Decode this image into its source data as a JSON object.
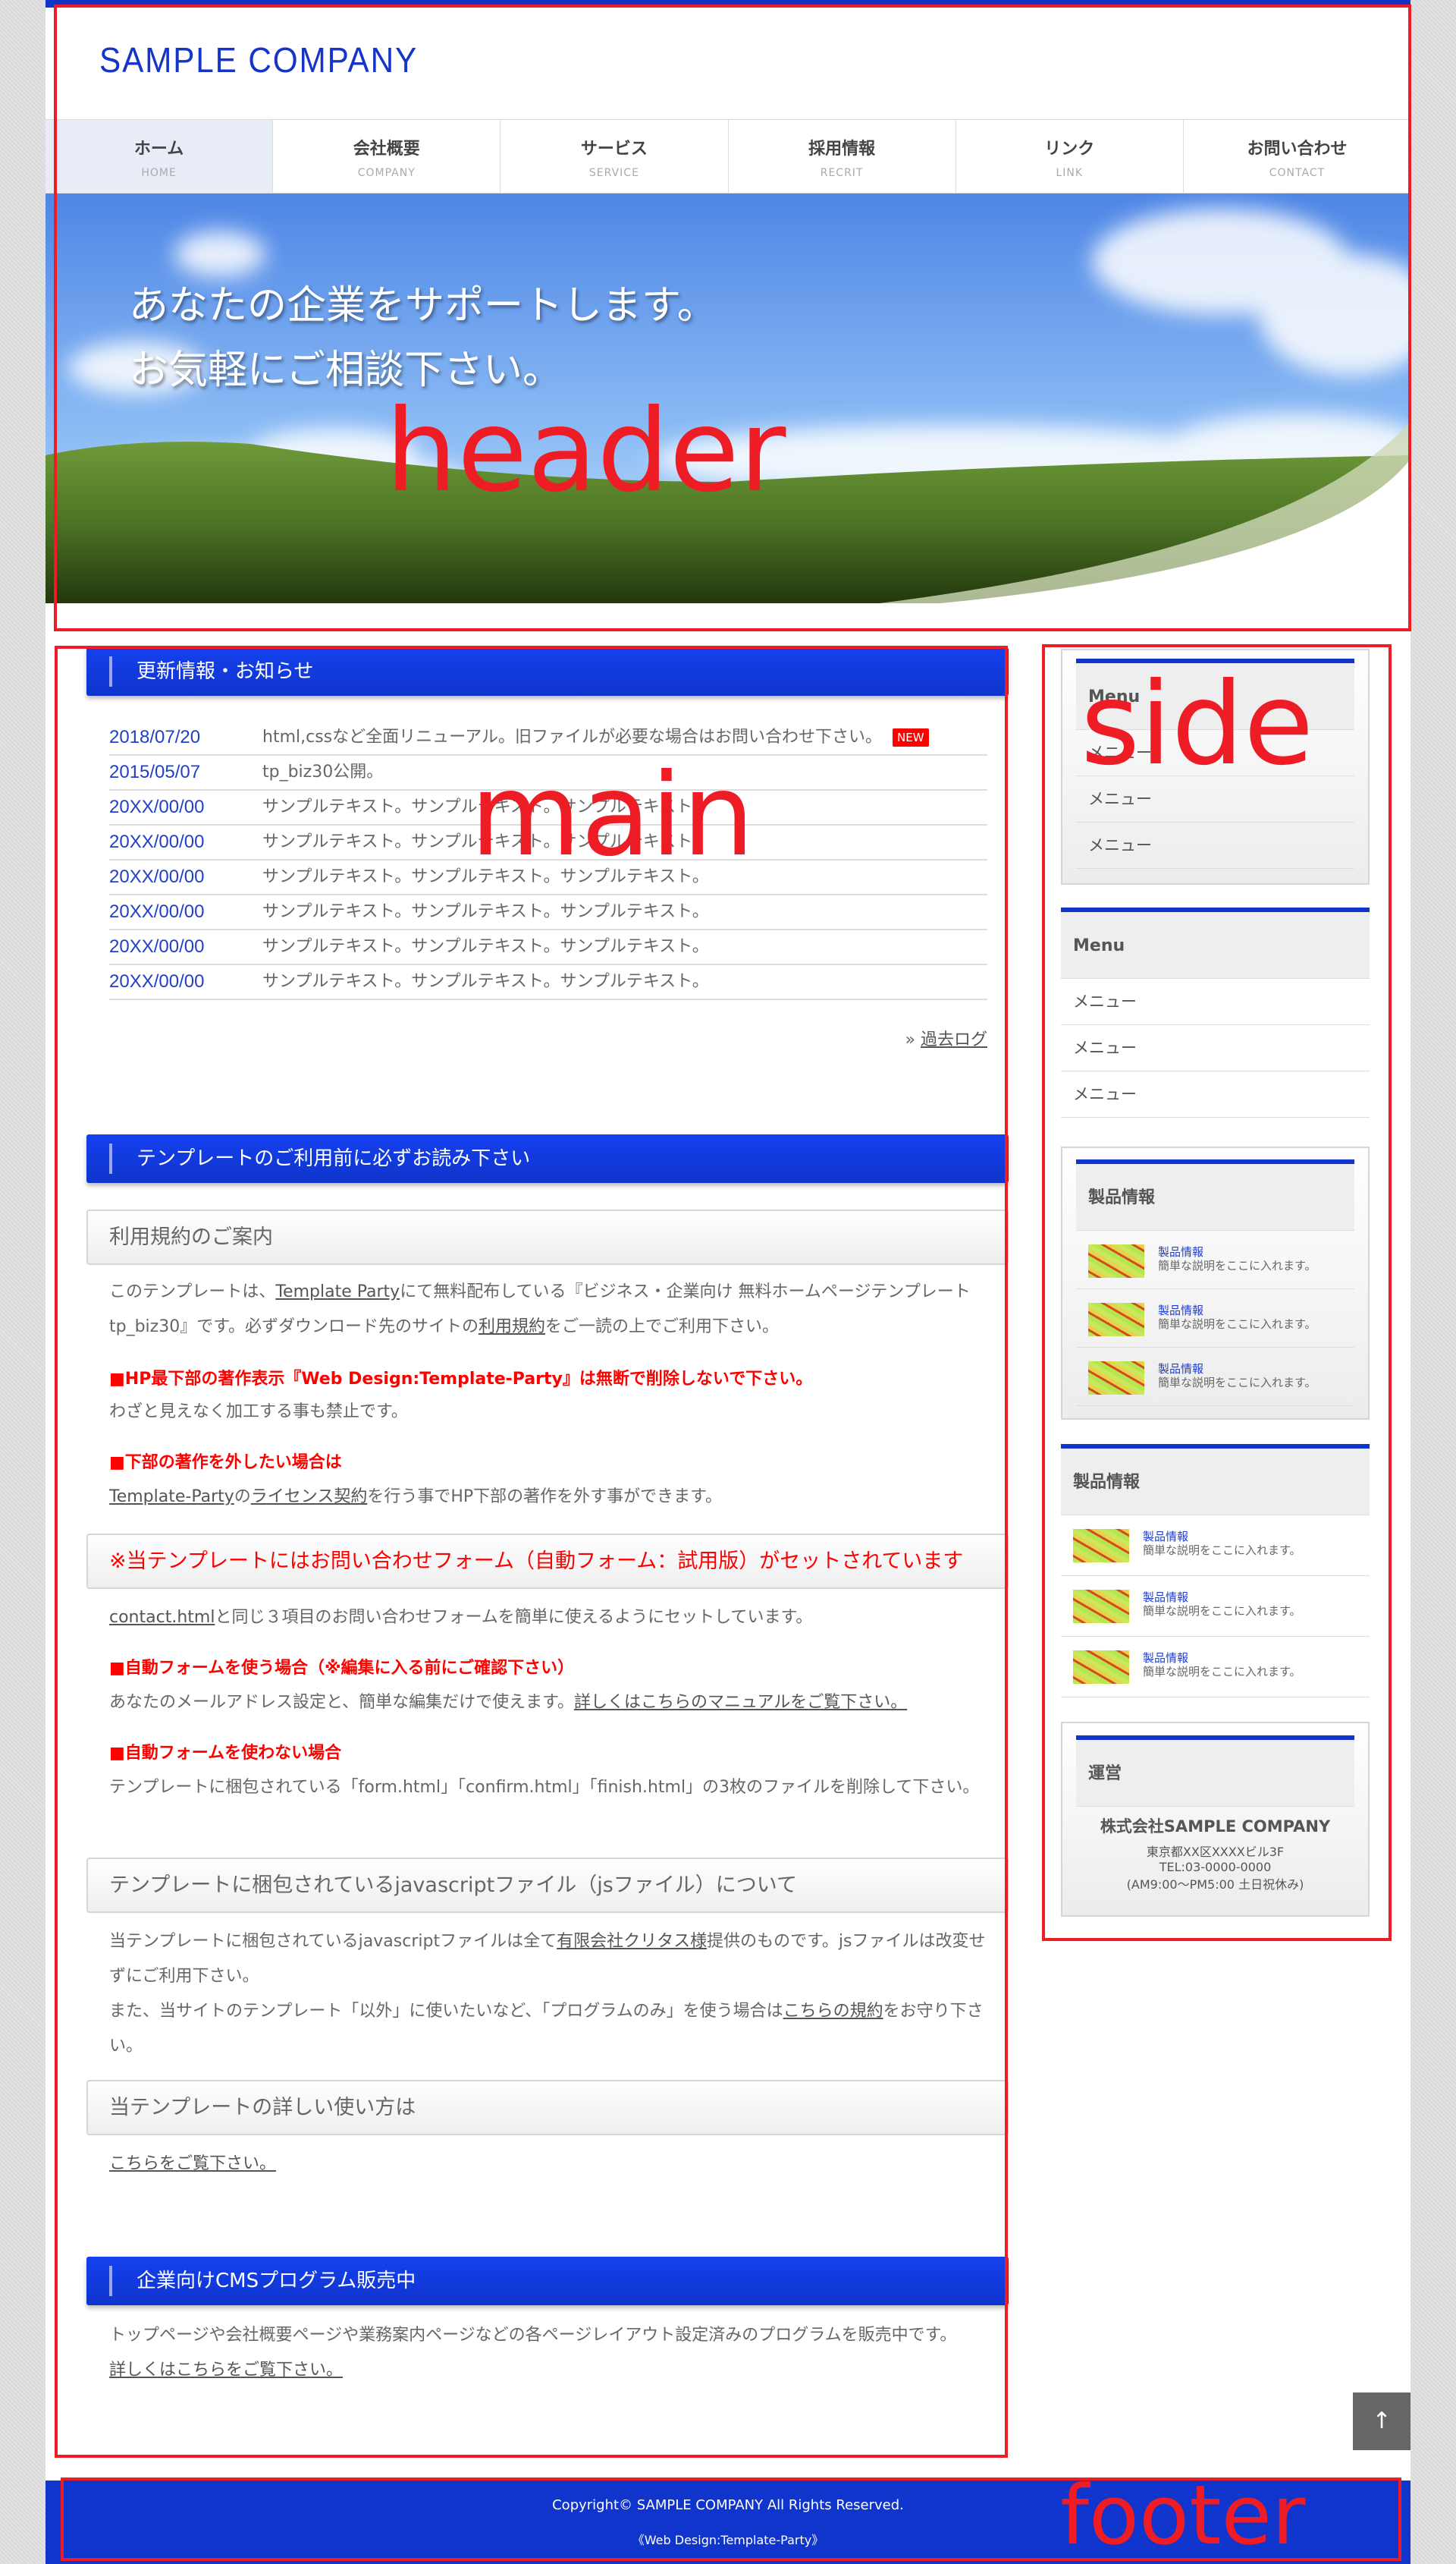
{
  "header": {
    "logo": "SAMPLE COMPANY",
    "nav": [
      {
        "jp": "ホーム",
        "en": "HOME"
      },
      {
        "jp": "会社概要",
        "en": "COMPANY"
      },
      {
        "jp": "サービス",
        "en": "SERVICE"
      },
      {
        "jp": "採用情報",
        "en": "RECRIT"
      },
      {
        "jp": "リンク",
        "en": "LINK"
      },
      {
        "jp": "お問い合わせ",
        "en": "CONTACT"
      }
    ],
    "hero": {
      "line1": "あなたの企業をサポートします。",
      "line2": "お気軽にご相談下さい。"
    }
  },
  "news": {
    "title": "更新情報・お知らせ",
    "badge": "NEW",
    "more_prefix": "»",
    "more": "過去ログ",
    "items": [
      {
        "date": "2018/07/20",
        "text": "html,cssなど全面リニューアル。旧ファイルが必要な場合はお問い合わせ下さい。"
      },
      {
        "date": "2015/05/07",
        "text": "tp_biz30公開。"
      },
      {
        "date": "20XX/00/00",
        "text": "サンプルテキスト。サンプルテキスト。サンプルテキスト。"
      },
      {
        "date": "20XX/00/00",
        "text": "サンプルテキスト。サンプルテキスト。サンプルテキスト。"
      },
      {
        "date": "20XX/00/00",
        "text": "サンプルテキスト。サンプルテキスト。サンプルテキスト。"
      },
      {
        "date": "20XX/00/00",
        "text": "サンプルテキスト。サンプルテキスト。サンプルテキスト。"
      },
      {
        "date": "20XX/00/00",
        "text": "サンプルテキスト。サンプルテキスト。サンプルテキスト。"
      },
      {
        "date": "20XX/00/00",
        "text": "サンプルテキスト。サンプルテキスト。サンプルテキスト。"
      }
    ]
  },
  "notice": {
    "title": "テンプレートのご利用前に必ずお読み下さい",
    "terms": {
      "title": "利用規約のご案内",
      "p1a": "このテンプレートは、",
      "p1link": "Template Party",
      "p1b": "にて無料配布している『ビジネス・企業向け 無料ホームページテンプレート tp_biz30』です。必ずダウンロード先のサイトの",
      "p1link2": "利用規約",
      "p1c": "をご一読の上でご利用下さい。",
      "h1": "■HP最下部の著作表示『Web Design:Template-Party』は無断で削除しないで下さい。",
      "t1": "わざと見えなく加工する事も禁止です。",
      "h2": "■下部の著作を外したい場合は",
      "t2link": "Template-Party",
      "t2a": "の",
      "t2link2": "ライセンス契約",
      "t2b": "を行う事でHP下部の著作を外す事ができます。"
    },
    "form": {
      "title": "※当テンプレートにはお問い合わせフォーム（自動フォーム：試用版）がセットされています",
      "p1link": "contact.html",
      "p1": "と同じ３項目のお問い合わせフォームを簡単に使えるようにセットしています。",
      "h1": "■自動フォームを使う場合（※編集に入る前にご確認下さい）",
      "t1": "あなたのメールアドレス設定と、簡単な編集だけで使えます。",
      "t1link": "詳しくはこちらのマニュアルをご覧下さい。",
      "h2": "■自動フォームを使わない場合",
      "t2": "テンプレートに梱包されている「form.html」「confirm.html」「finish.html」の3枚のファイルを削除して下さい。"
    },
    "js": {
      "title": "テンプレートに梱包されているjavascriptファイル（jsファイル）について",
      "p1a": "当テンプレートに梱包されているjavascriptファイルは全て",
      "p1link": "有限会社クリタス様",
      "p1b": "提供のものです。jsファイルは改変せずにご利用下さい。",
      "p2a": "また、当サイトのテンプレート「以外」に使いたいなど、「プログラムのみ」を使う場合は",
      "p2link": "こちらの規約",
      "p2b": "をお守り下さい。"
    },
    "usage": {
      "title": "当テンプレートの詳しい使い方は",
      "link": "こちらをご覧下さい。"
    }
  },
  "cms": {
    "title": "企業向けCMSプログラム販売中",
    "text": "トップページや会社概要ページや業務案内ページなどの各ページレイアウト設定済みのプログラムを販売中です。",
    "link": "詳しくはこちらをご覧下さい。"
  },
  "side": {
    "menu1": {
      "title": "Menu",
      "items": [
        "メニュー",
        "メニュー",
        "メニュー"
      ]
    },
    "menu2": {
      "title": "Menu",
      "items": [
        "メニュー",
        "メニュー",
        "メニュー"
      ]
    },
    "products1": {
      "title": "製品情報",
      "items": [
        {
          "name": "製品情報",
          "desc": "簡単な説明をここに入れます。"
        },
        {
          "name": "製品情報",
          "desc": "簡単な説明をここに入れます。"
        },
        {
          "name": "製品情報",
          "desc": "簡単な説明をここに入れます。"
        }
      ]
    },
    "products2": {
      "title": "製品情報",
      "items": [
        {
          "name": "製品情報",
          "desc": "簡単な説明をここに入れます。"
        },
        {
          "name": "製品情報",
          "desc": "簡単な説明をここに入れます。"
        },
        {
          "name": "製品情報",
          "desc": "簡単な説明をここに入れます。"
        }
      ]
    },
    "operator": {
      "title": "運営",
      "company": "株式会社SAMPLE COMPANY",
      "address": "東京都XX区XXXXビル3F",
      "tel": "TEL:03-0000-0000",
      "hours": "(AM9:00〜PM5:00 土日祝休み)"
    }
  },
  "footer": {
    "copyright": "Copyright© SAMPLE COMPANY All Rights Reserved.",
    "credit_open": "《",
    "credit": "Web Design:Template-Party",
    "credit_close": "》"
  },
  "totop": {
    "icon": "arrow-up-icon",
    "label": "↑"
  },
  "annotations": {
    "header": "header",
    "main": "main",
    "side": "side",
    "footer": "footer",
    "color": "#ee1c25"
  },
  "colors": {
    "brand": "#1135c9",
    "accent_red": "#ff0000",
    "date": "#1f3fcc"
  }
}
